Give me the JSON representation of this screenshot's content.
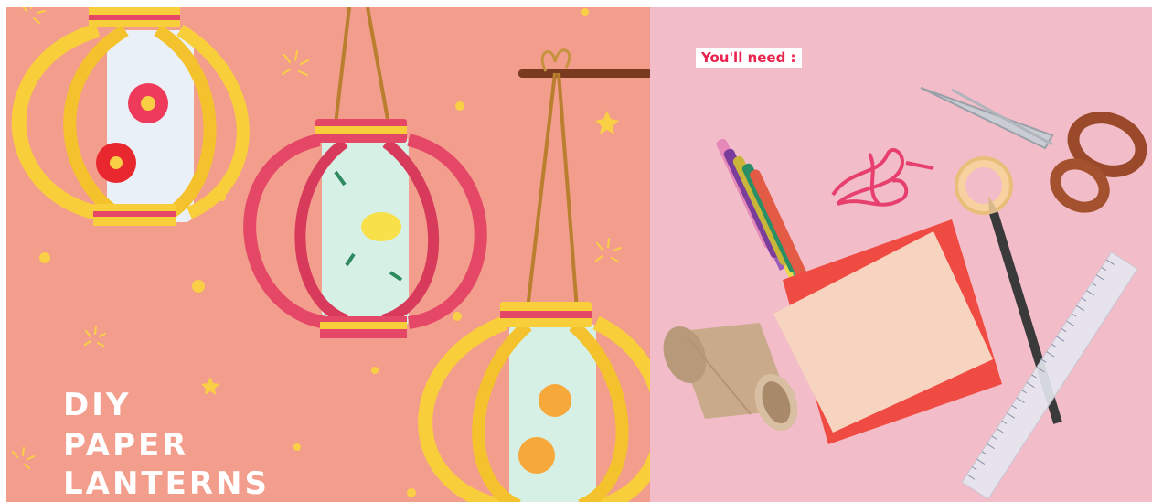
{
  "left": {
    "title_lines": [
      "DIY",
      "PAPER",
      "LANTERNS"
    ],
    "corner_badge": "",
    "colors": {
      "background": "#f39d8c",
      "yellow": "#f8cf3a",
      "pink": "#e44866"
    }
  },
  "right": {
    "tag": "You'll need :",
    "colors": {
      "background": "#f2bcc8"
    },
    "items": [
      "markers",
      "pink-yarn",
      "tape-roll",
      "scissors",
      "pencil",
      "ruler",
      "paper-sheets",
      "cardboard-tube"
    ]
  }
}
